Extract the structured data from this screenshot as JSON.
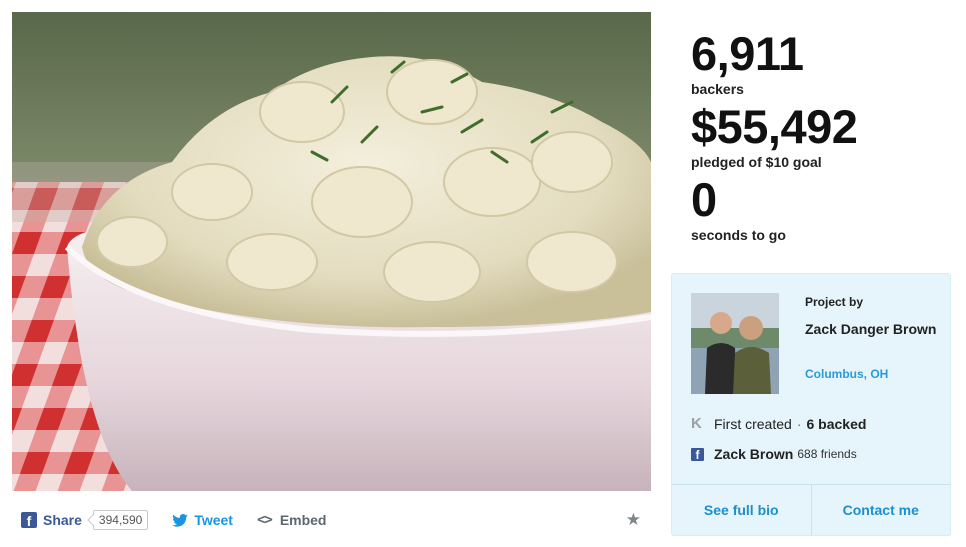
{
  "share": {
    "facebook_label": "Share",
    "facebook_count": "394,590",
    "tweet_label": "Tweet",
    "embed_label": "Embed",
    "icons": [
      "facebook-icon",
      "twitter-icon",
      "code-icon",
      "star-icon"
    ]
  },
  "stats": {
    "backers_value": "6,911",
    "backers_label": "backers",
    "pledged_value": "$55,492",
    "pledged_label": "pledged of $10 goal",
    "time_value": "0",
    "time_label": "seconds to go"
  },
  "creator": {
    "project_by_label": "Project by",
    "name": "Zack Danger Brown",
    "location": "Columbus, OH",
    "first_created": "First created",
    "separator": "·",
    "backed": "6 backed",
    "facebook_name": "Zack Brown",
    "facebook_friends": "688 friends",
    "see_full_bio": "See full bio",
    "contact_me": "Contact me"
  },
  "colors": {
    "link_blue": "#1c8fce",
    "facebook_blue": "#3b5998",
    "twitter_blue": "#1b95e0",
    "card_bg": "#e6f4fb"
  }
}
